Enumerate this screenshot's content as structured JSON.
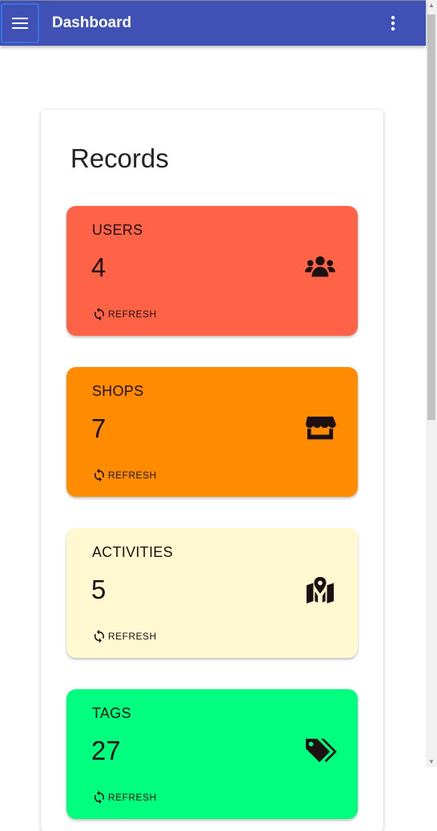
{
  "header": {
    "title": "Dashboard",
    "menu_icon": "menu-icon",
    "more_icon": "more-vert-icon"
  },
  "panel": {
    "title": "Records"
  },
  "cards": [
    {
      "label": "USERS",
      "value": "4",
      "icon": "users-icon",
      "color": "#ff6347",
      "refresh": "REFRESH"
    },
    {
      "label": "SHOPS",
      "value": "7",
      "icon": "store-icon",
      "color": "#ff8c00",
      "refresh": "REFRESH"
    },
    {
      "label": "ACTIVITIES",
      "value": "5",
      "icon": "map-marker-icon",
      "color": "#fff8d0",
      "refresh": "REFRESH"
    },
    {
      "label": "TAGS",
      "value": "27",
      "icon": "tags-icon",
      "color": "#00ff7f",
      "refresh": "REFRESH"
    }
  ]
}
